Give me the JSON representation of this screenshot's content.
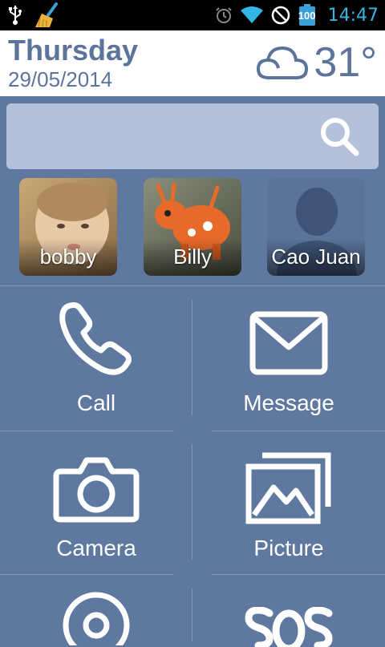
{
  "status_bar": {
    "battery": "100",
    "time": "14:47"
  },
  "header": {
    "day": "Thursday",
    "date": "29/05/2014",
    "temperature": "31°"
  },
  "contacts": [
    {
      "name": "bobby"
    },
    {
      "name": "Billy"
    },
    {
      "name": "Cao Juan"
    }
  ],
  "tiles": [
    {
      "label": "Call",
      "icon": "phone-icon"
    },
    {
      "label": "Message",
      "icon": "envelope-icon"
    },
    {
      "label": "Camera",
      "icon": "camera-icon"
    },
    {
      "label": "Picture",
      "icon": "picture-icon"
    },
    {
      "label": "",
      "icon": "target-icon"
    },
    {
      "label": "",
      "icon": "sos-icon"
    }
  ],
  "colors": {
    "background": "#5e78a0",
    "header_text": "#5c739b",
    "search_bar": "#b3c1da",
    "clock": "#33b5e5"
  }
}
